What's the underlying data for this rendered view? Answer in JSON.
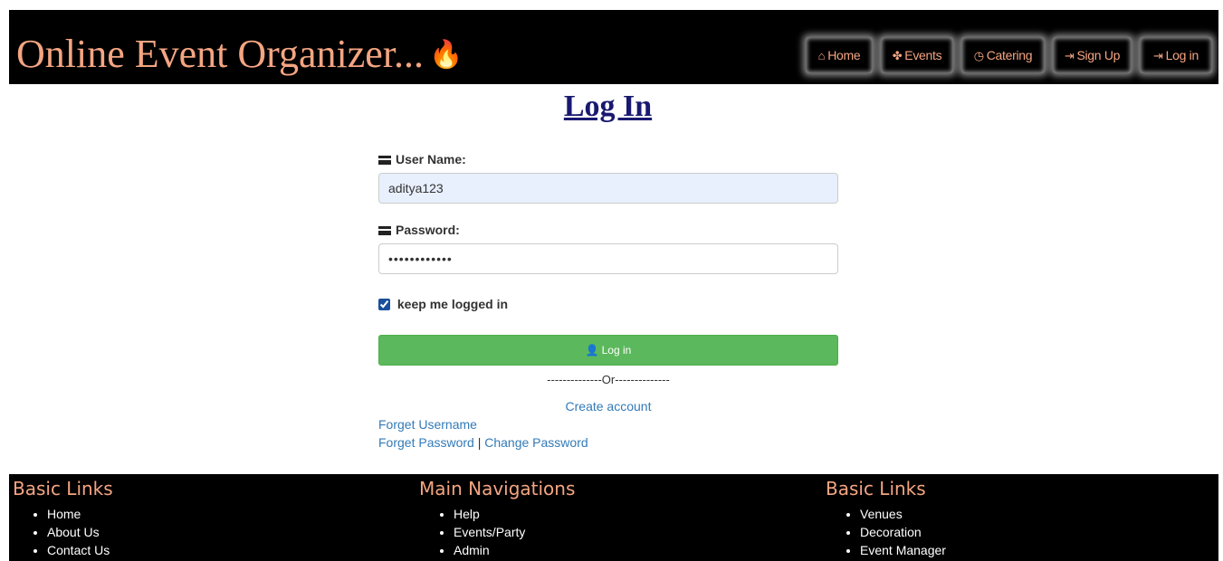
{
  "header": {
    "site_title": "Online Event Organizer...",
    "title_icon": "flame-icon",
    "nav": [
      {
        "label": "Home",
        "icon": "home-icon"
      },
      {
        "label": "Events",
        "icon": "gift-icon"
      },
      {
        "label": "Catering",
        "icon": "clock-icon"
      },
      {
        "label": "Sign Up",
        "icon": "login-arrow-icon"
      },
      {
        "label": "Log in",
        "icon": "login-arrow-icon"
      }
    ]
  },
  "login": {
    "heading": "Log In",
    "username_label": "User Name:",
    "username_value": "aditya123",
    "password_label": "Password:",
    "password_value": "aditya123456",
    "remember_label": "keep me logged in",
    "remember_checked": true,
    "login_button": "Log in",
    "or_separator": "--------------Or--------------",
    "create_account": "Create account",
    "forget_username": "Forget Username",
    "forget_password": "Forget Password",
    "separator": "|",
    "change_password": "Change Password"
  },
  "footer": {
    "columns": [
      {
        "title": "Basic Links",
        "items": [
          "Home",
          "About Us",
          "Contact Us"
        ]
      },
      {
        "title": "Main Navigations",
        "items": [
          "Help",
          "Events/Party",
          "Admin"
        ]
      },
      {
        "title": "Basic Links",
        "items": [
          "Venues",
          "Decoration",
          "Event Manager"
        ]
      }
    ]
  },
  "colors": {
    "accent": "#f4a582",
    "header_bg": "#000000",
    "heading": "#191970",
    "button": "#5cb85c",
    "link": "#337ab7",
    "input_autofill": "#e8f0fe"
  }
}
